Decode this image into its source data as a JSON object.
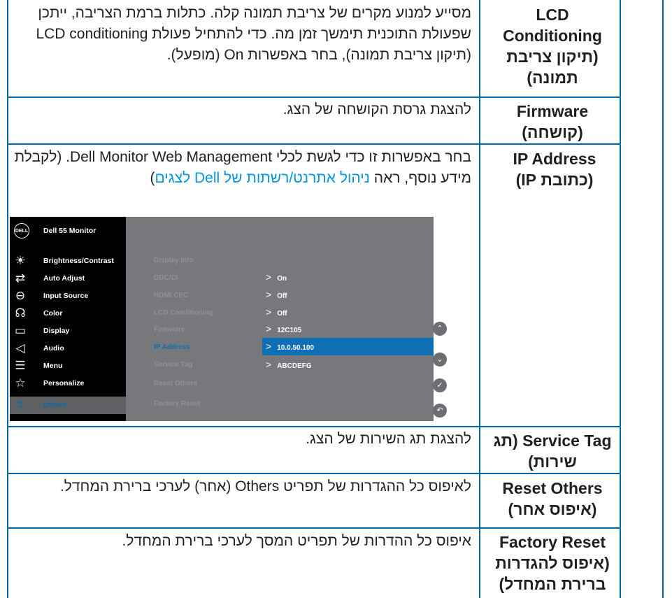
{
  "rows": [
    {
      "label": "LCD Conditioning (תיקון צריבת תמונה)",
      "desc": "מסייע למנוע מקרים של צריבת תמונה קלה. כתלות ברמת הצריבה, ייתכן שפעולת התוכנית תימשך זמן מה. כדי להתחיל פעולת LCD conditioning (תיקון צריבת תמונה), בחר באפשרות On (מופעל)."
    },
    {
      "label": "Firmware (קושחה)",
      "desc": "להצגת גרסת הקושחה של הצג."
    },
    {
      "label": "IP Address (כתובת IP)",
      "desc_before": "בחר באפשרות זו כדי לגשת לכלי Dell Monitor Web Management. (לקבלת מידע נוסף, ראה ",
      "desc_link": "ניהול אתרנט/רשתות של Dell לצגים",
      "desc_after": ")"
    },
    {
      "label": "Service Tag (תג שירות)",
      "desc": "להצגת תג השירות של הצג."
    },
    {
      "label": "Reset Others (איפוס אחר)",
      "desc": "לאיפוס כל ההגדרות של תפריט Others (אחר) לערכי ברירת המחדל."
    },
    {
      "label": "Factory Reset (איפוס להגדרות ברירת המחדל)",
      "desc": "איפוס כל ההדרות של תפריט המסך לערכי ברירת המחדל."
    }
  ],
  "osd": {
    "logo": "DELL",
    "title": "Dell 55 Monitor",
    "menu": [
      {
        "icon": "brightness-icon",
        "label": "Brightness/Contrast"
      },
      {
        "icon": "auto-adjust-icon",
        "label": "Auto Adjust"
      },
      {
        "icon": "input-source-icon",
        "label": "Input Source"
      },
      {
        "icon": "color-icon",
        "label": "Color"
      },
      {
        "icon": "display-icon",
        "label": "Display"
      },
      {
        "icon": "audio-icon",
        "label": "Audio"
      },
      {
        "icon": "menu-icon",
        "label": "Menu"
      },
      {
        "icon": "star-icon",
        "label": "Personalize"
      },
      {
        "icon": "others-icon",
        "label": "Others",
        "selected": true
      }
    ],
    "submenu": [
      "Display Info",
      "DDC/CI",
      "HDMI CEC",
      "LCD Conditioning",
      "Firmware",
      "IP Address",
      "Service Tag",
      "Reset Others",
      "Factory Reset"
    ],
    "values": {
      "ddc_ci": "On",
      "hdmi_cec": "Off",
      "lcd_conditioning": "Off",
      "firmware": "12C105",
      "ip_address": "10.0.50.100",
      "service_tag": "ABCDEFG"
    },
    "highlight_color": "#0f6fb5",
    "selected_item": "IP Address"
  }
}
